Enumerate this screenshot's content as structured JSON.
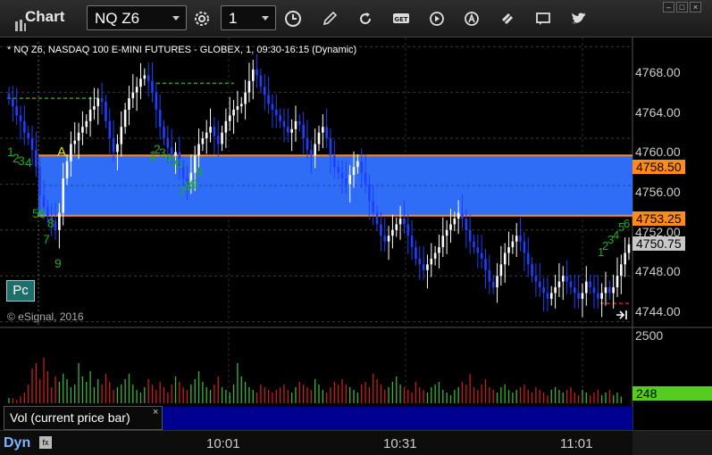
{
  "app": {
    "title": "Chart"
  },
  "toolbar": {
    "symbol": "NQ Z6",
    "interval": "1",
    "icons": [
      "settings-icon",
      "clock-icon",
      "pencil-icon",
      "refresh-icon",
      "get-icon",
      "play-icon",
      "alert-icon",
      "link-icon",
      "chat-icon",
      "twitter-icon"
    ],
    "get_label": "GET"
  },
  "chart": {
    "header": "* NQ Z6, NASDAQ 100 E-MINI FUTURES - GLOBEX, 1, 09:30-16:15 (Dynamic)",
    "copyright": "© eSignal, 2016",
    "pc_button": "Pc",
    "annotation_a": "A",
    "seq_left": [
      "1",
      "2",
      "3",
      "4",
      "5",
      "6",
      "7",
      "8",
      "9"
    ],
    "seq_mid": [
      "1",
      "2",
      "3",
      "4",
      "5",
      "6",
      "7",
      "8",
      "9"
    ],
    "seq_right": [
      "1",
      "2",
      "3",
      "4",
      "5",
      "6"
    ],
    "price_axis": [
      "4768.00",
      "4764.00",
      "4760.00",
      "4756.00",
      "4752.00",
      "4748.00",
      "4744.00"
    ],
    "band_top_label": "4758.50",
    "band_bottom_label": "4753.25",
    "current_price_label": "4750.75",
    "colors": {
      "band": "#2f6df7",
      "band_border": "#ff8c1a",
      "up_candle": "#ffffff",
      "down_candle": "#1f3fff",
      "seq_green": "#22aa22",
      "vol_up": "#3cb43c",
      "vol_down": "#c81e1e"
    }
  },
  "volume": {
    "label": "Vol (current price bar)",
    "close": "×",
    "axis_top": "2500",
    "current": "248"
  },
  "bottom": {
    "mode": "Dyn",
    "times": [
      "10:01",
      "10:31",
      "11:01"
    ]
  },
  "chart_data": {
    "type": "candlestick",
    "title": "* NQ Z6, NASDAQ 100 E-MINI FUTURES - GLOBEX, 1, 09:30-16:15 (Dynamic)",
    "ylim": [
      4743.5,
      4768.8
    ],
    "y_ticks": [
      4744,
      4748,
      4752,
      4756,
      4760,
      4764,
      4768
    ],
    "x_ticks": [
      "10:01",
      "10:31",
      "11:01"
    ],
    "band": {
      "top": 4758.5,
      "bottom": 4753.25
    },
    "last_price": 4750.75,
    "closes": [
      4763.5,
      4762.8,
      4762.0,
      4761.5,
      4760.5,
      4760.0,
      4759.0,
      4757.5,
      4755.0,
      4754.0,
      4753.2,
      4752.8,
      4752.0,
      4753.5,
      4756.5,
      4758.0,
      4759.5,
      4759.8,
      4760.5,
      4761.0,
      4761.5,
      4762.5,
      4762.8,
      4763.5,
      4763.2,
      4761.5,
      4760.0,
      4758.8,
      4759.5,
      4761.0,
      4762.5,
      4763.5,
      4764.0,
      4764.5,
      4765.2,
      4765.5,
      4765.0,
      4764.0,
      4762.5,
      4761.0,
      4760.0,
      4759.2,
      4758.5,
      4758.8,
      4757.5,
      4756.5,
      4756.0,
      4757.0,
      4758.5,
      4759.5,
      4760.0,
      4760.5,
      4761.0,
      4760.2,
      4759.5,
      4760.5,
      4761.5,
      4762.0,
      4762.5,
      4762.8,
      4763.0,
      4764.0,
      4765.0,
      4766.0,
      4765.5,
      4764.5,
      4763.8,
      4763.0,
      4762.5,
      4762.0,
      4761.5,
      4761.0,
      4760.5,
      4760.8,
      4761.5,
      4761.2,
      4760.0,
      4759.0,
      4758.5,
      4759.5,
      4760.5,
      4761.0,
      4760.0,
      4758.5,
      4757.5,
      4757.0,
      4756.5,
      4756.0,
      4756.8,
      4757.5,
      4758.0,
      4757.0,
      4756.0,
      4754.5,
      4753.5,
      4752.5,
      4751.5,
      4751.0,
      4751.5,
      4752.0,
      4752.5,
      4753.0,
      4752.5,
      4751.5,
      4750.5,
      4749.5,
      4749.0,
      4748.5,
      4749.0,
      4749.5,
      4750.0,
      4750.5,
      4751.5,
      4752.0,
      4752.5,
      4753.0,
      4753.5,
      4753.0,
      4752.0,
      4751.0,
      4750.5,
      4750.0,
      4749.5,
      4748.5,
      4747.5,
      4747.0,
      4748.0,
      4749.0,
      4750.0,
      4750.5,
      4751.0,
      4751.5,
      4751.0,
      4750.0,
      4749.0,
      4748.0,
      4747.5,
      4747.0,
      4746.5,
      4746.0,
      4746.5,
      4747.0,
      4747.5,
      4748.0,
      4747.5,
      4747.0,
      4746.5,
      4746.0,
      4746.5,
      4747.5,
      4747.0,
      4746.5,
      4746.0,
      4746.5,
      4747.0,
      4746.5,
      4747.0,
      4748.0,
      4749.0,
      4750.0,
      4750.75
    ],
    "volume": [
      200,
      180,
      120,
      260,
      400,
      700,
      1300,
      1500,
      900,
      1700,
      1200,
      600,
      1000,
      800,
      1100,
      900,
      600,
      700,
      1500,
      1000,
      800,
      1200,
      600,
      900,
      700,
      1100,
      800,
      500,
      600,
      700,
      900,
      1100,
      700,
      500,
      400,
      600,
      900,
      700,
      500,
      800,
      600,
      400,
      700,
      1000,
      800,
      600,
      500,
      700,
      900,
      1200,
      800,
      600,
      500,
      700,
      1000,
      600,
      500,
      400,
      700,
      1500,
      1000,
      800,
      600,
      500,
      400,
      700,
      600,
      500,
      400,
      500,
      600,
      700,
      500,
      400,
      600,
      800,
      700,
      600,
      500,
      900,
      700,
      500,
      400,
      600,
      800,
      700,
      900,
      700,
      600,
      500,
      400,
      700,
      800,
      600,
      1100,
      900,
      700,
      500,
      600,
      800,
      1000,
      700,
      600,
      500,
      400,
      800,
      600,
      500,
      400,
      600,
      700,
      800,
      500,
      400,
      300,
      500,
      600,
      800,
      700,
      1100,
      600,
      500,
      700,
      900,
      600,
      500,
      400,
      600,
      700,
      500,
      400,
      500,
      600,
      700,
      500,
      400,
      600,
      500,
      400,
      300,
      500,
      600,
      500,
      400,
      500,
      600,
      400,
      300,
      500,
      400,
      300,
      400,
      500,
      300,
      400,
      500,
      300,
      400,
      248
    ]
  }
}
